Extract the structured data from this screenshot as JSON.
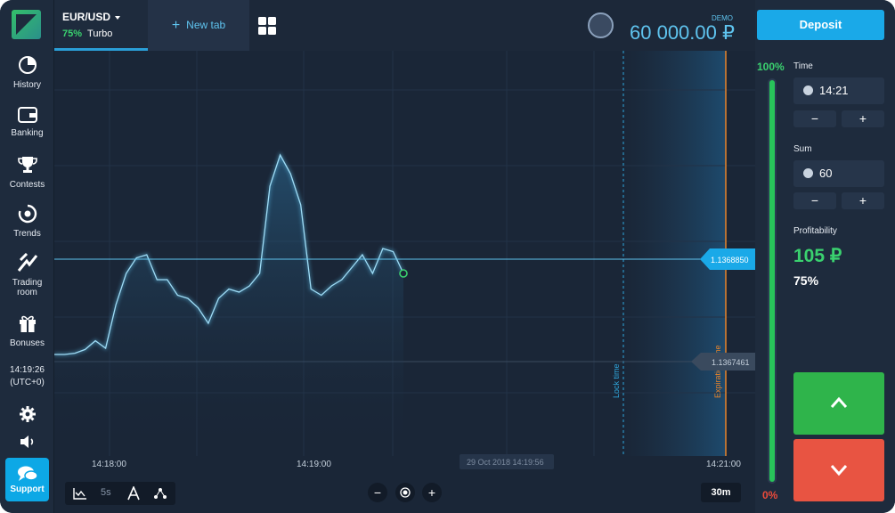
{
  "sidebar": {
    "items": [
      {
        "label": "History",
        "icon": "history-icon"
      },
      {
        "label": "Banking",
        "icon": "wallet-icon"
      },
      {
        "label": "Contests",
        "icon": "trophy-icon"
      },
      {
        "label": "Trends",
        "icon": "trends-icon"
      },
      {
        "label": "Trading",
        "label2": "room",
        "icon": "trading-room-icon"
      },
      {
        "label": "Bonuses",
        "icon": "gift-icon"
      }
    ],
    "clock_time": "14:19:26",
    "clock_tz": "(UTC+0)",
    "support_label": "Support"
  },
  "header": {
    "asset": "EUR/USD",
    "asset_percent": "75%",
    "asset_type": "Turbo",
    "new_tab_label": "New tab",
    "demo_label": "DEMO",
    "balance": "60 000.00 ₽"
  },
  "chart": {
    "time_labels": [
      "14:18:00",
      "14:19:00",
      "14:21:00"
    ],
    "hover_date": "29 Oct 2018 14:19:56",
    "current_price": "1.1368850",
    "strike_price": "1.1367461",
    "lock_time_label": "Lock time",
    "expiration_label": "Expiration time",
    "timeframe_label": "5s",
    "zoom_label": "30m",
    "colors": {
      "line": "#5fc4ef",
      "accent": "#1aa9e8",
      "expiration": "#e8842a"
    }
  },
  "chart_data": {
    "type": "line",
    "series": [
      {
        "values": [
          0.0,
          0.0,
          0.02,
          0.08,
          0.22,
          0.1,
          0.8,
          1.3,
          1.55,
          1.6,
          1.2,
          1.2,
          0.95,
          0.9,
          0.75,
          0.5,
          0.9,
          1.05,
          1.0,
          1.1,
          1.3,
          2.7,
          3.2,
          2.9,
          2.4,
          1.05,
          0.95,
          1.1,
          1.2,
          1.4,
          1.6,
          1.3,
          1.7,
          1.65,
          1.3
        ]
      }
    ]
  },
  "panel": {
    "deposit_label": "Deposit",
    "bar_top": "100%",
    "bar_bottom": "0%",
    "bar_fill_fraction": 1.0,
    "time_label": "Time",
    "time_value": "14:21",
    "sum_label": "Sum",
    "sum_value": "60",
    "minus": "−",
    "plus": "+",
    "profitability_label": "Profitability",
    "profit_value": "105 ₽",
    "profit_percent": "75%"
  }
}
